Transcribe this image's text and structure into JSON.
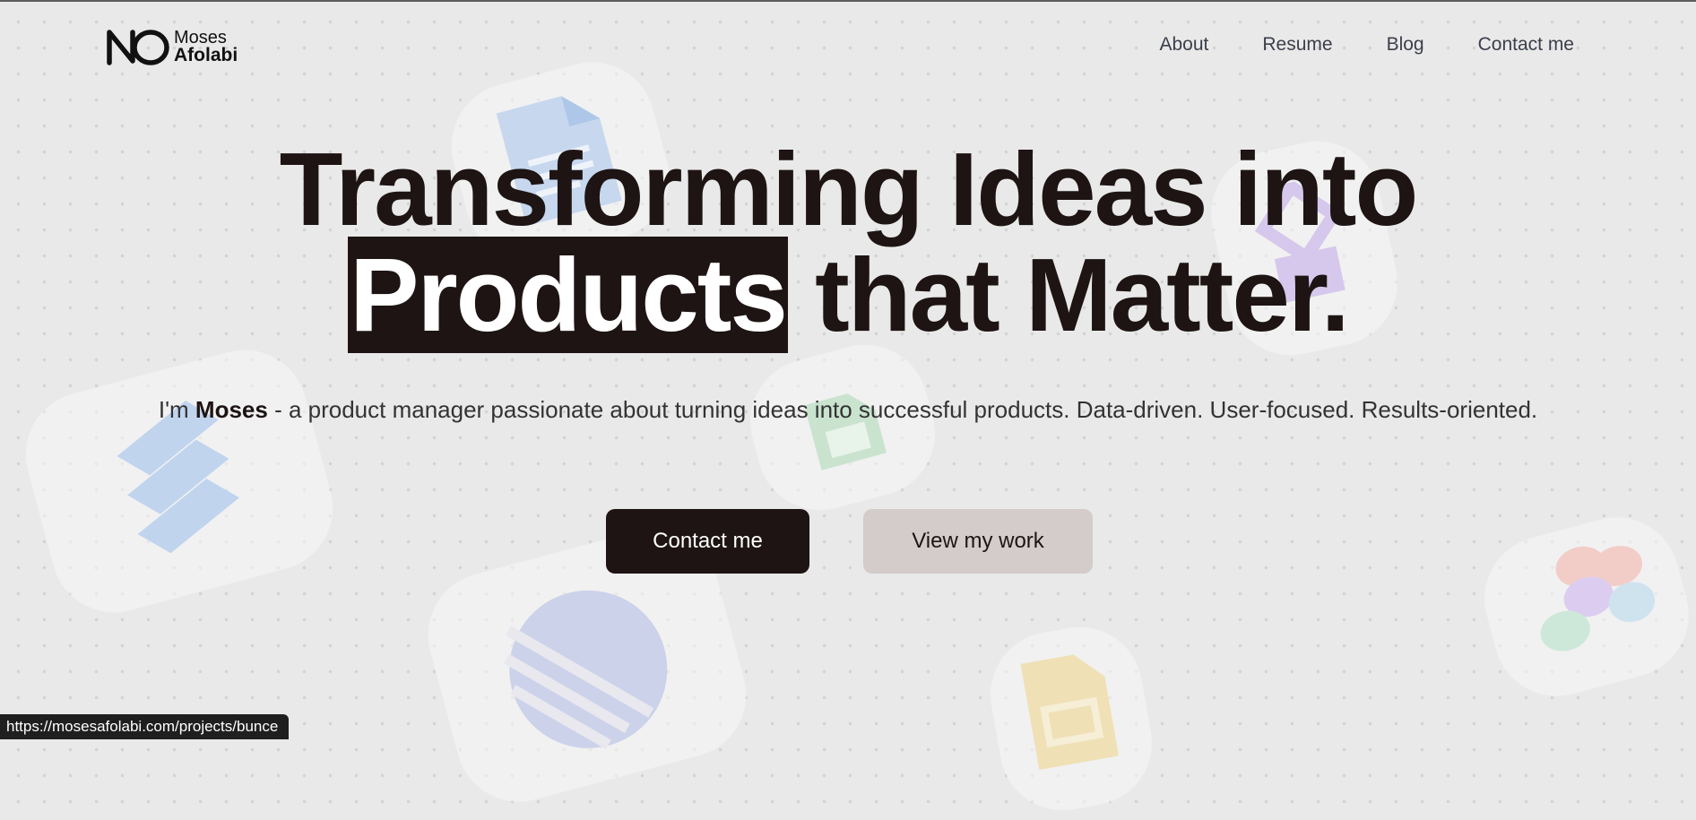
{
  "logo": {
    "first_name": "Moses",
    "last_name": "Afolabi"
  },
  "nav": {
    "items": [
      {
        "label": "About"
      },
      {
        "label": "Resume"
      },
      {
        "label": "Blog"
      },
      {
        "label": "Contact me"
      }
    ]
  },
  "hero": {
    "title_line1": "Transforming Ideas into",
    "title_highlight": "Products",
    "title_rest": " that Matter.",
    "intro_prefix": "I'm ",
    "intro_name": "Moses",
    "intro_suffix": " - a product manager passionate about turning ideas into successful products. Data-driven. User-focused. Results-oriented."
  },
  "buttons": {
    "primary_label": "Contact me",
    "secondary_label": "View my work"
  },
  "status_bar": {
    "url": "https://mosesafolabi.com/projects/bunce"
  },
  "colors": {
    "ink": "#1d1413",
    "background": "#e9e9e9",
    "secondary_button": "#d4cbcb",
    "nav_text": "#3b3f4a"
  },
  "background_icons": [
    "google-docs-icon",
    "clickup-icon",
    "google-sheets-icon",
    "linear-icon",
    "google-slides-icon",
    "zapier-icon",
    "figma-icon"
  ]
}
